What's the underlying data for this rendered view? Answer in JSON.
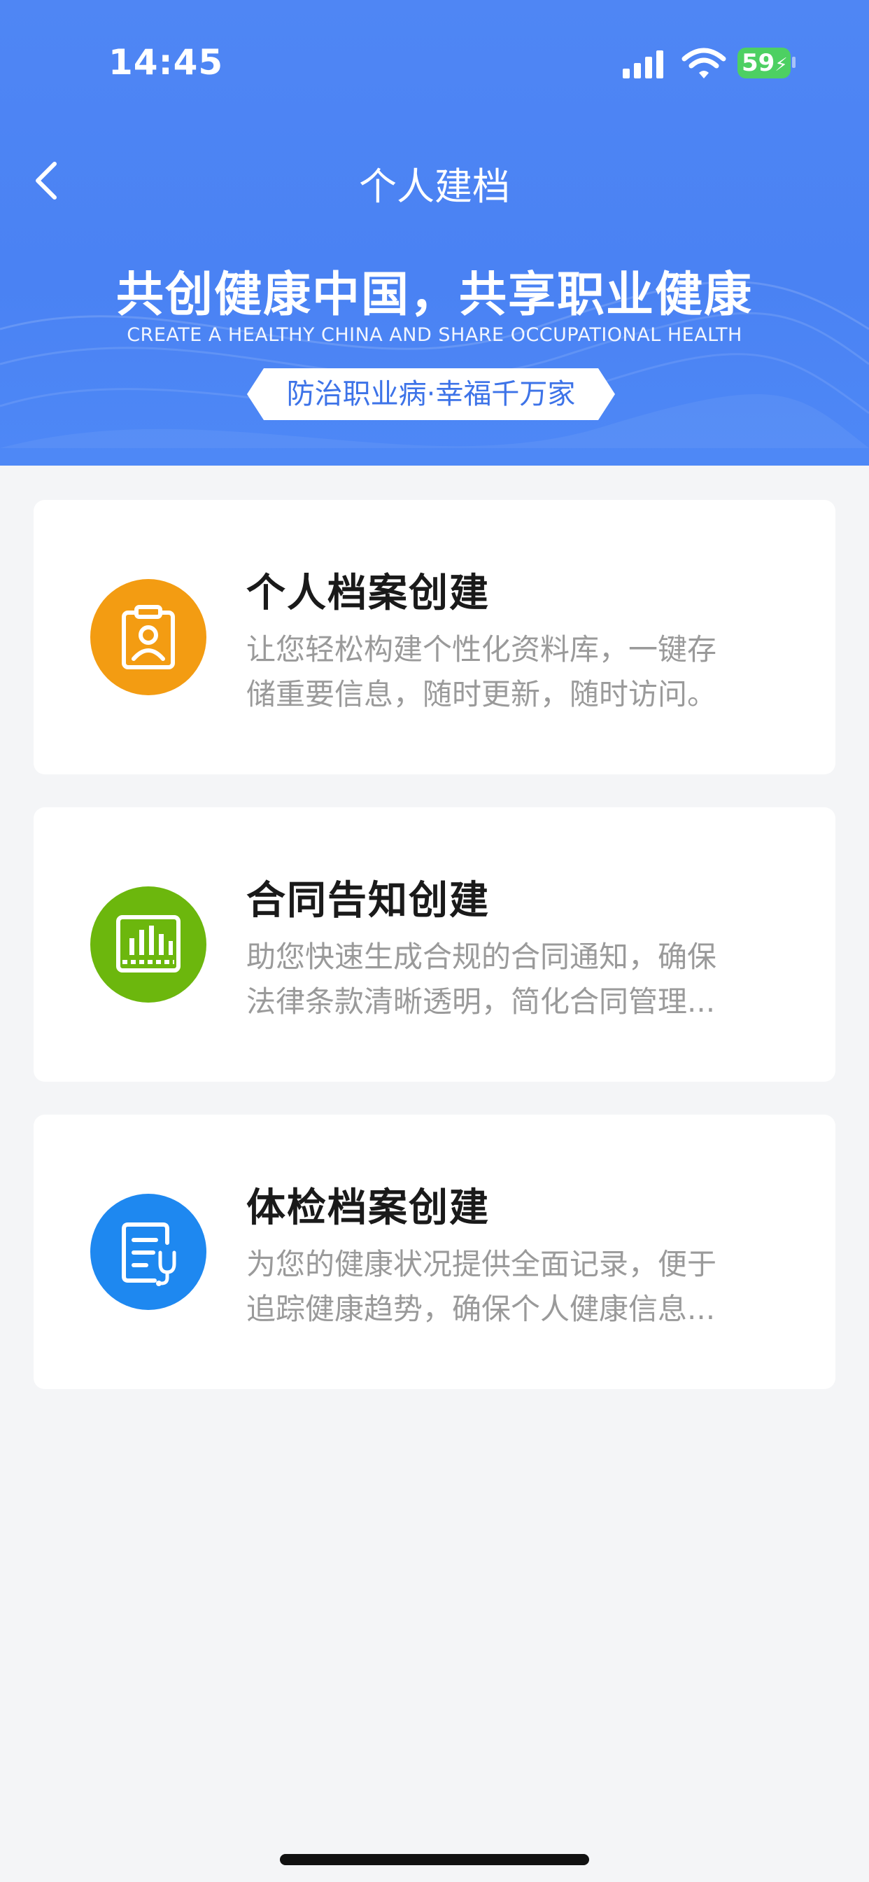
{
  "status_bar": {
    "time": "14:45",
    "battery": "59",
    "icons": [
      "signal-icon",
      "wifi-icon",
      "battery-charging-icon"
    ]
  },
  "nav": {
    "back_icon": "chevron-left-icon",
    "title": "个人建档"
  },
  "banner": {
    "slogan": "共创健康中国，共享职业健康",
    "slogan_en": "CREATE A HEALTHY CHINA AND SHARE OCCUPATIONAL HEALTH",
    "tag": "防治职业病·幸福千万家"
  },
  "cards": [
    {
      "icon": "personal-profile-icon",
      "icon_color": "#f39c12",
      "title": "个人档案创建",
      "desc_line1": "让您轻松构建个性化资料库，一键存",
      "desc_line2": "储重要信息，随时更新，随时访问。"
    },
    {
      "icon": "contract-chart-icon",
      "icon_color": "#6cb70d",
      "title": "合同告知创建",
      "desc_line1": "助您快速生成合规的合同通知，确保",
      "desc_line2": "法律条款清晰透明，简化合同管理..."
    },
    {
      "icon": "medical-record-icon",
      "icon_color": "#1e88f0",
      "title": "体检档案创建",
      "desc_line1": "为您的健康状况提供全面记录，便于",
      "desc_line2": "追踪健康趋势，确保个人健康信息..."
    }
  ]
}
